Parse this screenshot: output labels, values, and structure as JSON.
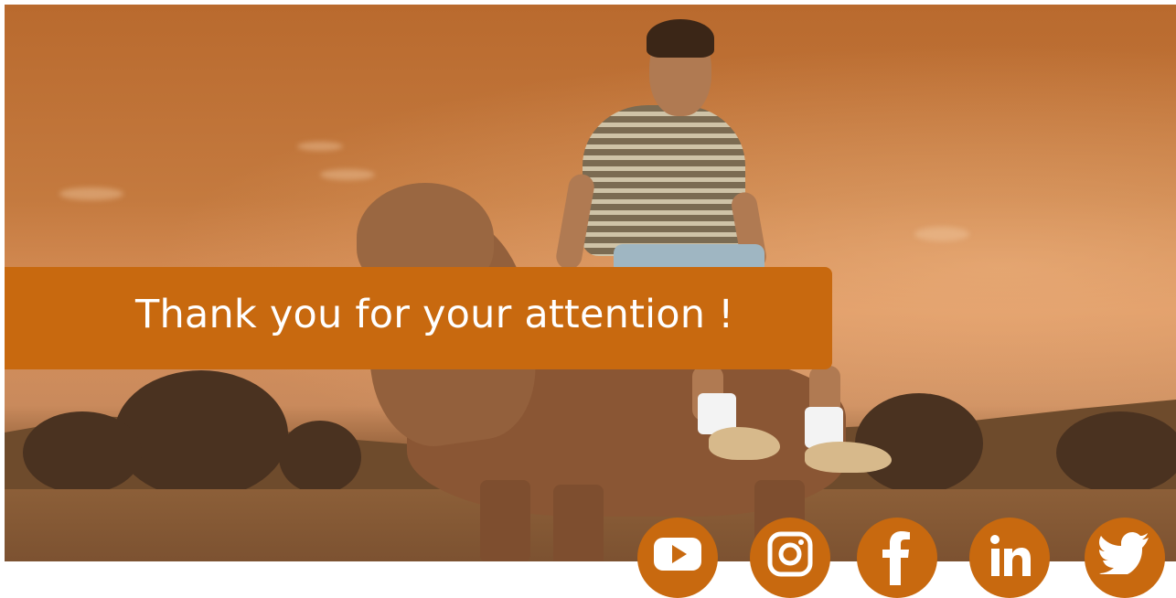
{
  "slide": {
    "title": "Thank you for your attention !",
    "banner_color": "#c8690f",
    "background": "sepia-toned photo of a smiling man riding a cow in a field"
  },
  "social_icons": [
    {
      "icon": "youtube-icon"
    },
    {
      "icon": "instagram-icon"
    },
    {
      "icon": "facebook-icon"
    },
    {
      "icon": "linkedin-icon"
    },
    {
      "icon": "twitter-icon"
    }
  ]
}
